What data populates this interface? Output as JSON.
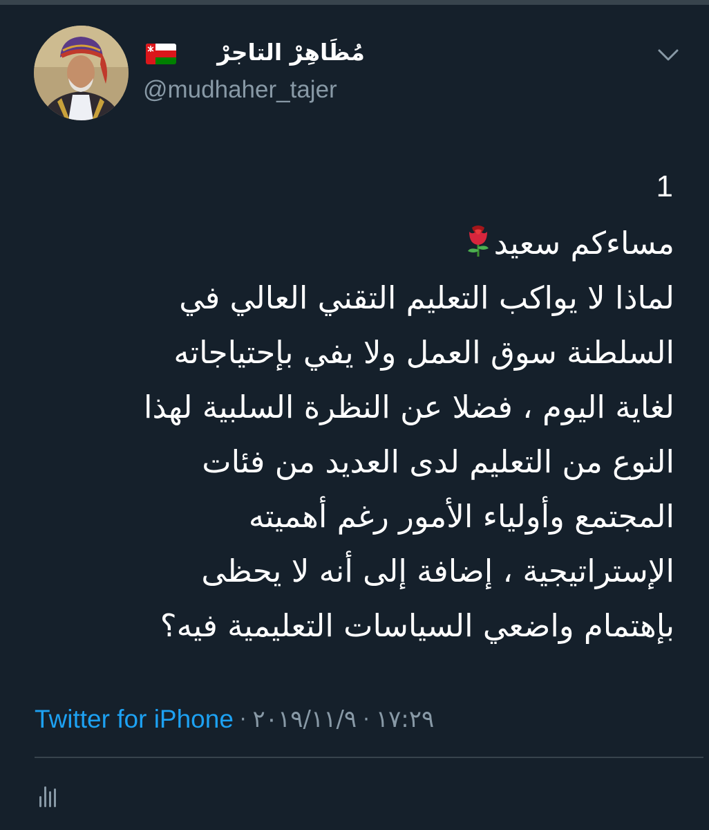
{
  "author": {
    "display_name": "مُظَاهِرْ التاجرْ",
    "handle": "@mudhaher_tajer",
    "avatar_icon": "avatar-portrait",
    "flag_icon": "oman-flag-icon"
  },
  "menu": {
    "icon": "chevron-down-icon"
  },
  "tweet": {
    "number": "1",
    "greeting": "مساءكم سعيد",
    "greeting_emoji_icon": "rose-icon",
    "lines": [
      "لماذا لا يواكب التعليم التقني العالي في",
      "السلطنة سوق العمل ولا يفي بإحتياجاته",
      "لغاية اليوم ، فضلا عن النظرة السلبية لهذا",
      "النوع من التعليم لدى العديد من فئات",
      "المجتمع وأولياء الأمور رغم أهميته",
      "الإستراتيجية ، إضافة إلى أنه لا يحظى",
      "بإهتمام واضعي السياسات التعليمية فيه؟"
    ]
  },
  "meta": {
    "source": "Twitter for iPhone",
    "separator": "·",
    "date": "٢٠١٩/١١/٩",
    "time": "١٧:٢٩"
  },
  "actions": {
    "stats_icon": "analytics-icon"
  },
  "colors": {
    "background": "#15202b",
    "text": "#ffffff",
    "secondary": "#8899a6",
    "link": "#1da1f2",
    "divider": "#38444d"
  }
}
